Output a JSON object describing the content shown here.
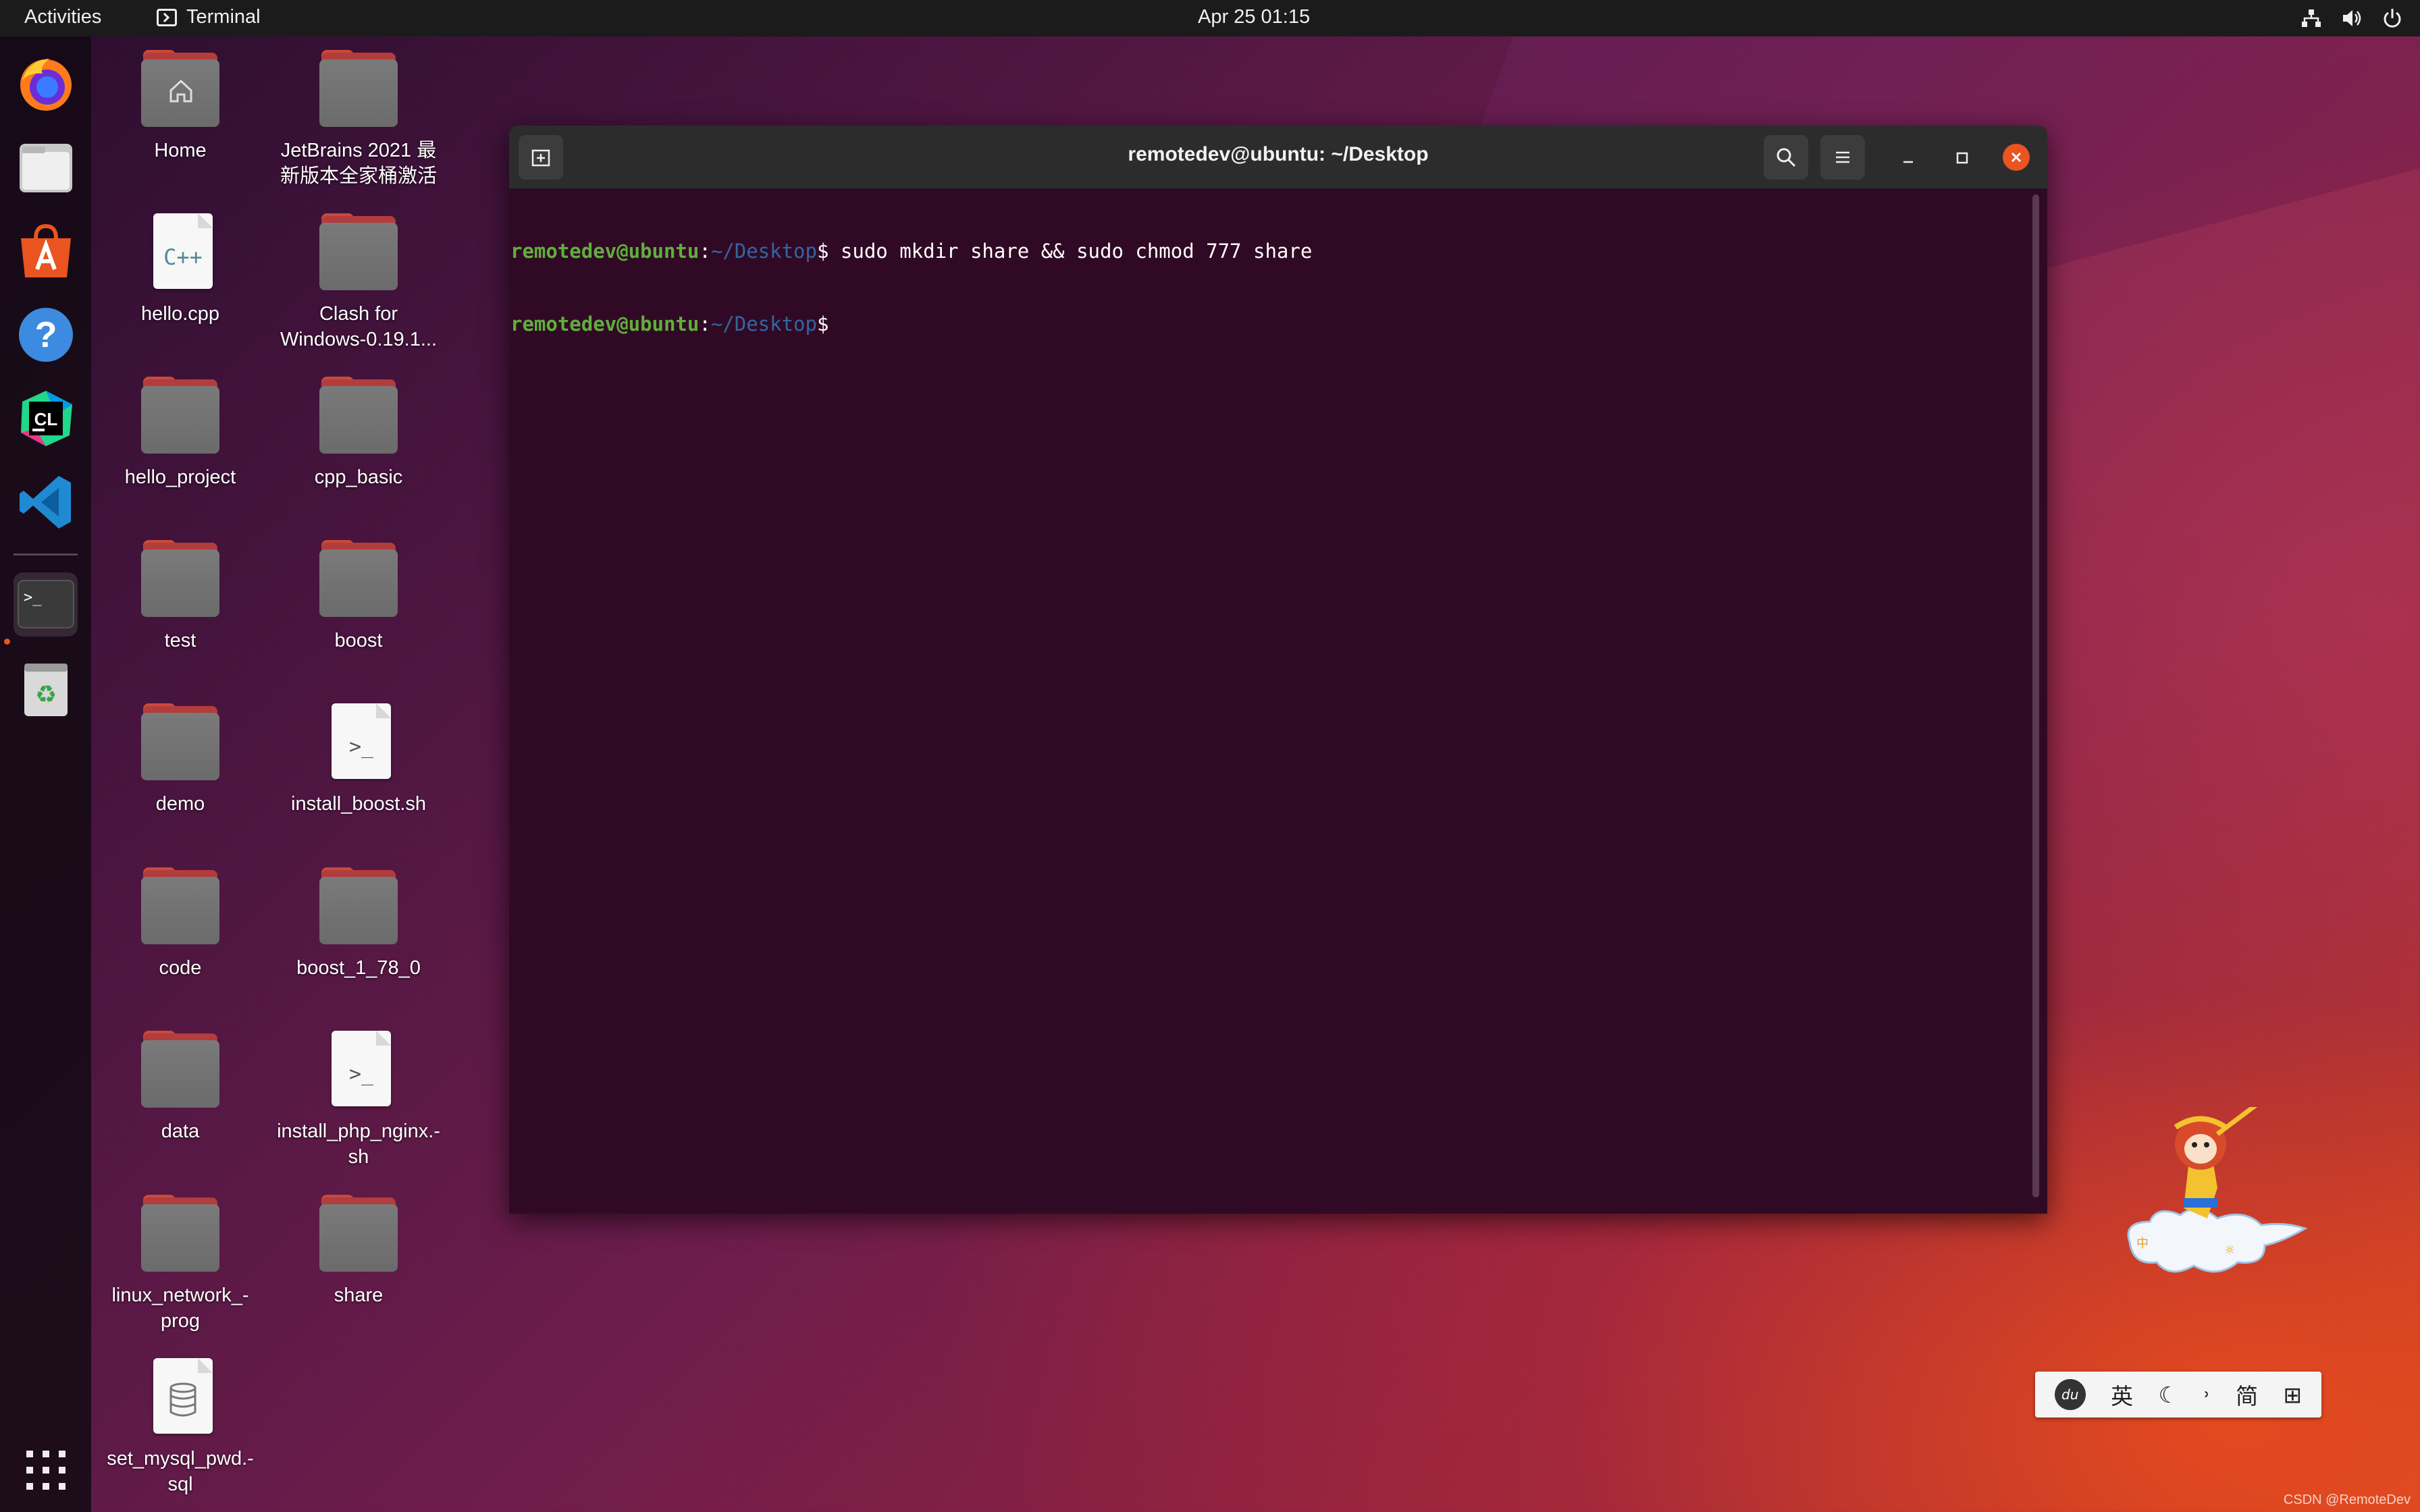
{
  "topbar": {
    "activities": "Activities",
    "app_name": "Terminal",
    "clock": "Apr 25  01:15"
  },
  "dock": {
    "apps": [
      "firefox-icon",
      "files-icon",
      "app-center-icon",
      "help-icon",
      "clion-icon",
      "vscode-icon",
      "terminal-icon",
      "trash-icon",
      "show-apps-icon"
    ]
  },
  "desktop": {
    "icons": [
      {
        "label": "Home",
        "type": "folder"
      },
      {
        "label": "JetBrains 2021 最\n新版本全家桶激活",
        "type": "folder"
      },
      {
        "label": "hello.cpp",
        "type": "cpp"
      },
      {
        "label": "Clash for\nWindows-0.19.1...",
        "type": "folder"
      },
      {
        "label": "hello_project",
        "type": "folder"
      },
      {
        "label": "cpp_basic",
        "type": "folder"
      },
      {
        "label": "test",
        "type": "folder"
      },
      {
        "label": "boost",
        "type": "folder"
      },
      {
        "label": "demo",
        "type": "folder"
      },
      {
        "label": "install_boost.sh",
        "type": "script"
      },
      {
        "label": "code",
        "type": "folder"
      },
      {
        "label": "boost_1_78_0",
        "type": "folder"
      },
      {
        "label": "data",
        "type": "folder"
      },
      {
        "label": "install_php_nginx.-\nsh",
        "type": "script"
      },
      {
        "label": "linux_network_-\nprog",
        "type": "folder"
      },
      {
        "label": "share",
        "type": "folder"
      },
      {
        "label": "set_mysql_pwd.-\nsql",
        "type": "sql"
      }
    ]
  },
  "terminal": {
    "title": "remotedev@ubuntu: ~/Desktop",
    "lines": [
      {
        "user": "remotedev@ubuntu",
        "path": "~/Desktop",
        "command": " sudo mkdir share && sudo chmod 777 share"
      },
      {
        "user": "remotedev@ubuntu",
        "path": "~/Desktop",
        "command": ""
      }
    ]
  },
  "ime": {
    "items": [
      "du",
      "英",
      "☾",
      "˒",
      "简",
      "⊞"
    ]
  },
  "watermark": "CSDN @RemoteDev"
}
